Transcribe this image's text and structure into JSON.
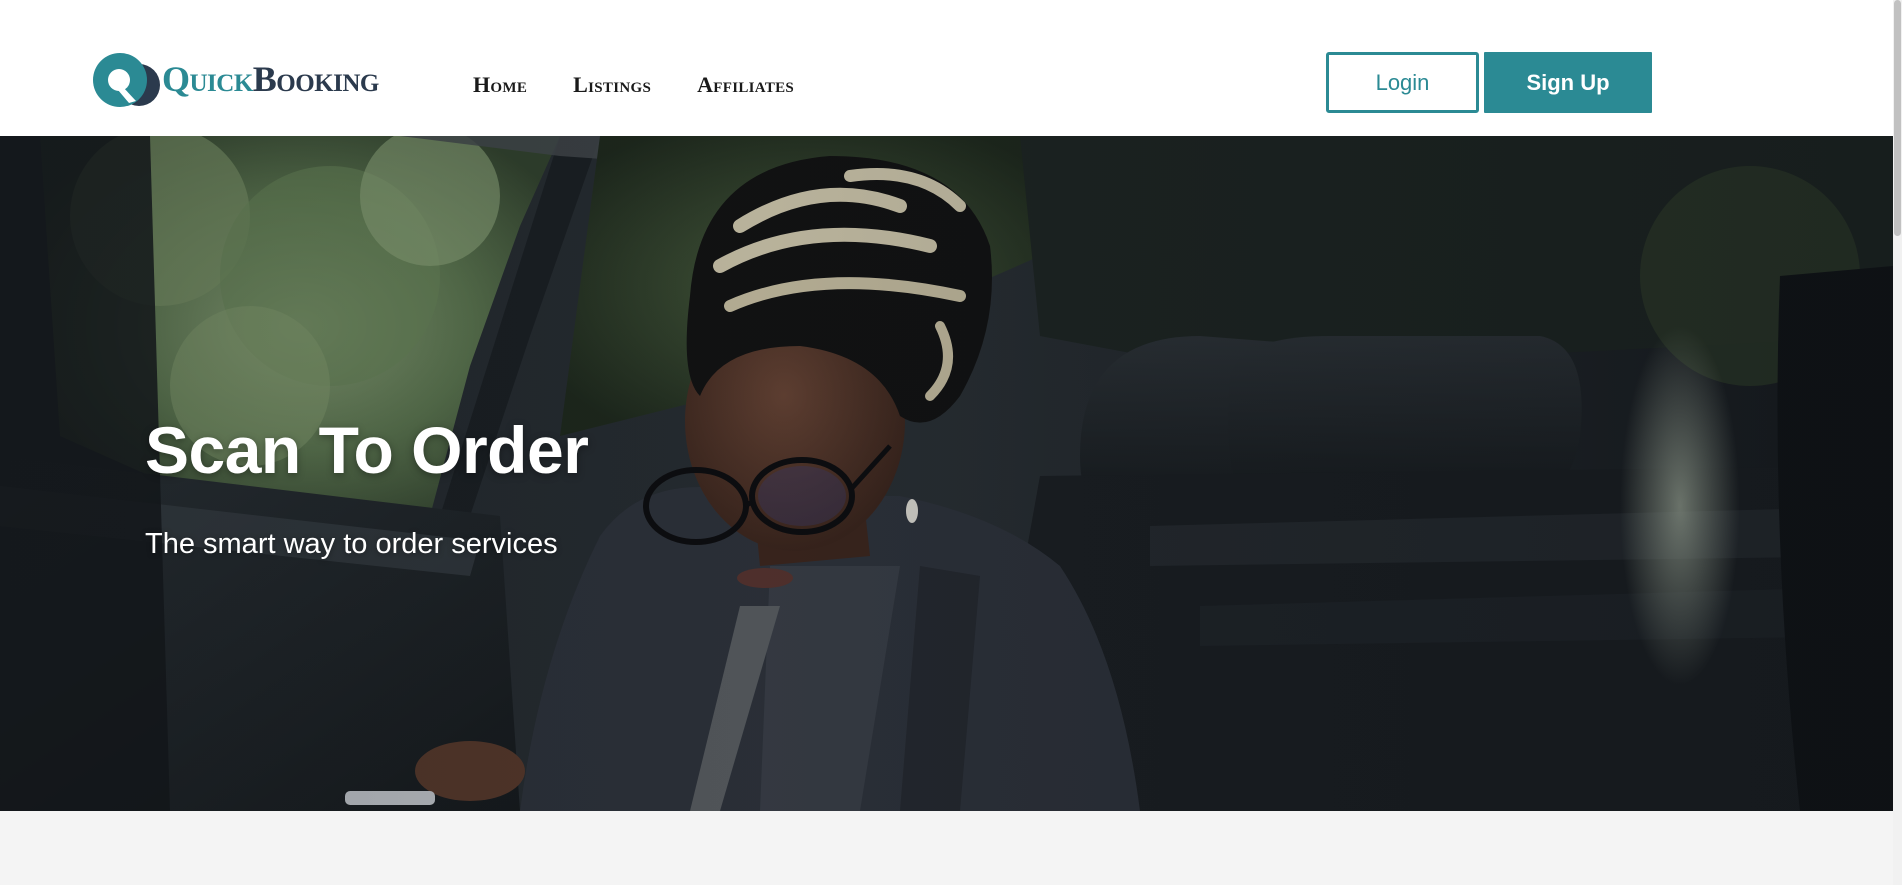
{
  "brand": {
    "name_part1": "Quick",
    "name_part2": "Booking",
    "colors": {
      "teal": "#2b8a94",
      "navy": "#2b3a4d"
    },
    "icon": "q-logo-icon"
  },
  "nav": {
    "items": [
      {
        "label": "Home"
      },
      {
        "label": "Listings"
      },
      {
        "label": "Affiliates"
      }
    ]
  },
  "auth": {
    "login_label": "Login",
    "signup_label": "Sign Up"
  },
  "hero": {
    "title": "Scan To Order",
    "subtitle": "The smart way to order services",
    "image": "woman-in-car-back-seat-photo"
  },
  "colors": {
    "accent": "#2b8a94",
    "page_background": "#f4f4f4",
    "header_background": "#ffffff"
  }
}
